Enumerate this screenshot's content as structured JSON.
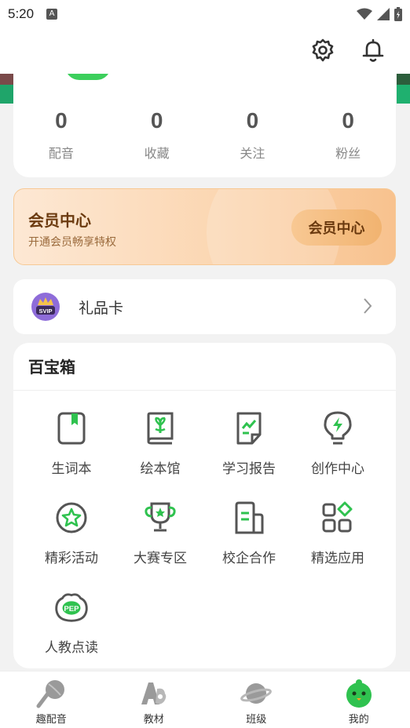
{
  "status_bar": {
    "time": "5:20",
    "notification_glyph": "A"
  },
  "stats": [
    {
      "value": "0",
      "label": "配音"
    },
    {
      "value": "0",
      "label": "收藏"
    },
    {
      "value": "0",
      "label": "关注"
    },
    {
      "value": "0",
      "label": "粉丝"
    }
  ],
  "vip": {
    "title": "会员中心",
    "subtitle": "开通会员畅享特权",
    "button_label": "会员中心"
  },
  "gift": {
    "label": "礼品卡",
    "badge": "SVIP"
  },
  "toolbox": {
    "title": "百宝箱",
    "items": [
      {
        "label": "生词本",
        "icon": "vocabulary-book-icon"
      },
      {
        "label": "绘本馆",
        "icon": "picture-book-icon"
      },
      {
        "label": "学习报告",
        "icon": "study-report-icon"
      },
      {
        "label": "创作中心",
        "icon": "creation-bulb-icon"
      },
      {
        "label": "精彩活动",
        "icon": "activity-star-icon"
      },
      {
        "label": "大赛专区",
        "icon": "trophy-icon"
      },
      {
        "label": "校企合作",
        "icon": "school-cooperation-icon"
      },
      {
        "label": "精选应用",
        "icon": "apps-grid-icon"
      },
      {
        "label": "人教点读",
        "icon": "pep-reader-icon",
        "badge": "PEP"
      }
    ]
  },
  "tabs": [
    {
      "label": "趣配音",
      "icon": "microphone-icon"
    },
    {
      "label": "教材",
      "icon": "textbook-icon"
    },
    {
      "label": "班级",
      "icon": "planet-icon"
    },
    {
      "label": "我的",
      "icon": "mascot-icon",
      "active": true
    }
  ],
  "colors": {
    "accent_green": "#2fc24f",
    "vip_text": "#6b3a0f",
    "icon_gray": "#555555"
  }
}
